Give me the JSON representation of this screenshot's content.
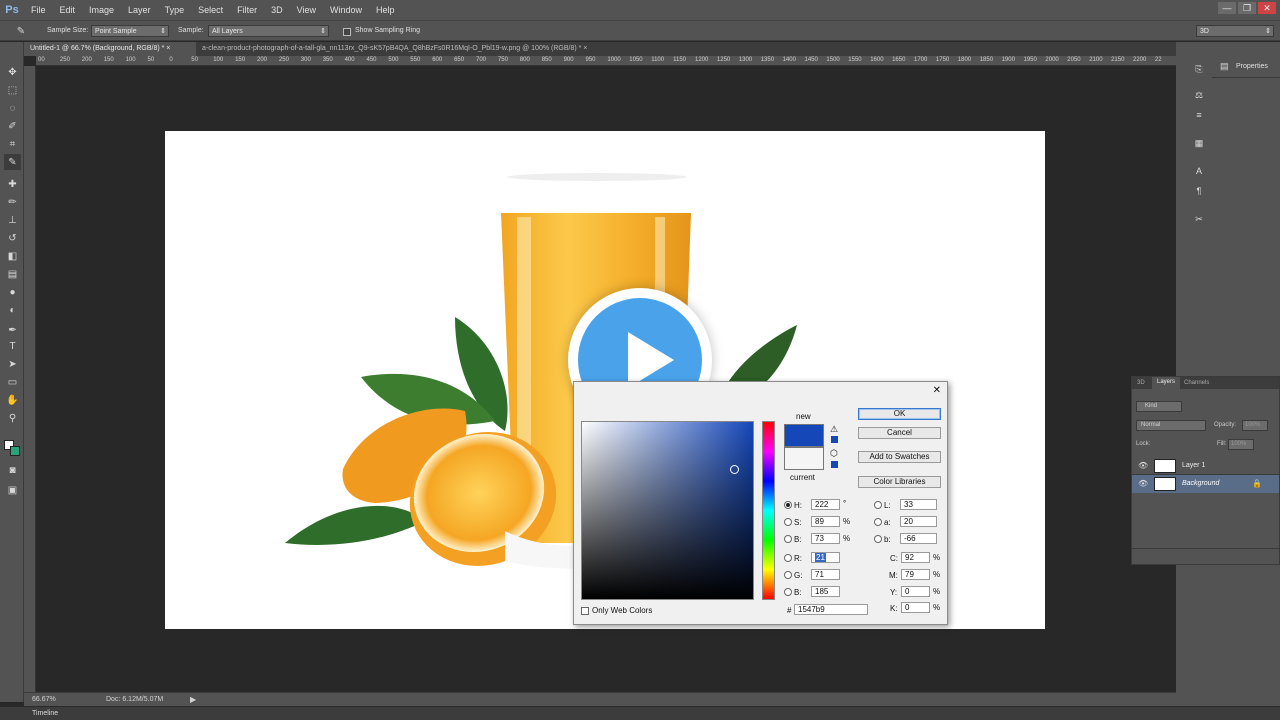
{
  "app": {
    "logo": "Ps"
  },
  "menu": [
    "File",
    "Edit",
    "Image",
    "Layer",
    "Type",
    "Select",
    "Filter",
    "3D",
    "View",
    "Window",
    "Help"
  ],
  "window_controls": {
    "minimize": "—",
    "restore": "❐",
    "close": "✕"
  },
  "options_bar": {
    "sample_size_label": "Sample Size:",
    "sample_size_value": "Point Sample",
    "sample_label": "Sample:",
    "sample_value": "All Layers",
    "show_ring_label": "Show Sampling Ring",
    "workspace_value": "3D"
  },
  "tabs": [
    {
      "label": "Untitled-1 @ 66.7% (Background, RGB/8) *",
      "close": "×"
    },
    {
      "label": "a-clean-product-photograph-of-a-tall-gla_nn113rx_Q9-sK57pB4QA_Q8hBzFs0R16MqI-O_Pbl19-w.png @ 100% (RGB/8) *",
      "close": "×"
    }
  ],
  "ruler_h": [
    "00",
    "250",
    "200",
    "150",
    "100",
    "50",
    "0",
    "50",
    "100",
    "150",
    "200",
    "250",
    "300",
    "350",
    "400",
    "450",
    "500",
    "550",
    "600",
    "650",
    "700",
    "750",
    "800",
    "850",
    "900",
    "950",
    "1000",
    "1050",
    "1100",
    "1150",
    "1200",
    "1250",
    "1300",
    "1350",
    "1400",
    "1450",
    "1500",
    "1550",
    "1600",
    "1650",
    "1700",
    "1750",
    "1800",
    "1850",
    "1900",
    "1950",
    "2000",
    "2050",
    "2100",
    "2150",
    "2200",
    "22"
  ],
  "right_panel": {
    "properties": "Properties"
  },
  "layers_panel": {
    "tabs": [
      "3D",
      "Layers",
      "Channels"
    ],
    "kind": "Kind",
    "blend_mode": "Normal",
    "opacity_label": "Opacity:",
    "opacity_value": "100%",
    "lock_label": "Lock:",
    "fill_label": "Fill:",
    "fill_value": "100%",
    "layers": [
      {
        "name": "Layer 1"
      },
      {
        "name": "Background"
      }
    ]
  },
  "status": {
    "zoom": "66.67%",
    "doc": "Doc: 6.12M/5.07M"
  },
  "timeline": "Timeline",
  "color_picker": {
    "new_label": "new",
    "current_label": "current",
    "buttons": {
      "ok": "OK",
      "cancel": "Cancel",
      "add_swatches": "Add to Swatches",
      "libraries": "Color Libraries"
    },
    "only_web": "Only Web Colors",
    "fields": {
      "H": "222",
      "S": "89",
      "B": "73",
      "R": "21",
      "G": "71",
      "Bl": "185",
      "L": "33",
      "a": "20",
      "b": "-66",
      "C": "92",
      "M": "79",
      "Y": "0",
      "K": "0"
    },
    "hex": "1547b9",
    "labels": {
      "H": "H:",
      "S": "S:",
      "B": "B:",
      "R": "R:",
      "G": "G:",
      "Bl": "B:",
      "L": "L:",
      "a": "a:",
      "b": "b:",
      "C": "C:",
      "M": "M:",
      "Y": "Y:",
      "K": "K:",
      "hash": "#"
    },
    "units": {
      "deg": "°",
      "pct": "%"
    },
    "close": "✕",
    "colors": {
      "new": "#1547b9",
      "current": "#f5f5f5",
      "hue_field": "#1547b9"
    }
  }
}
